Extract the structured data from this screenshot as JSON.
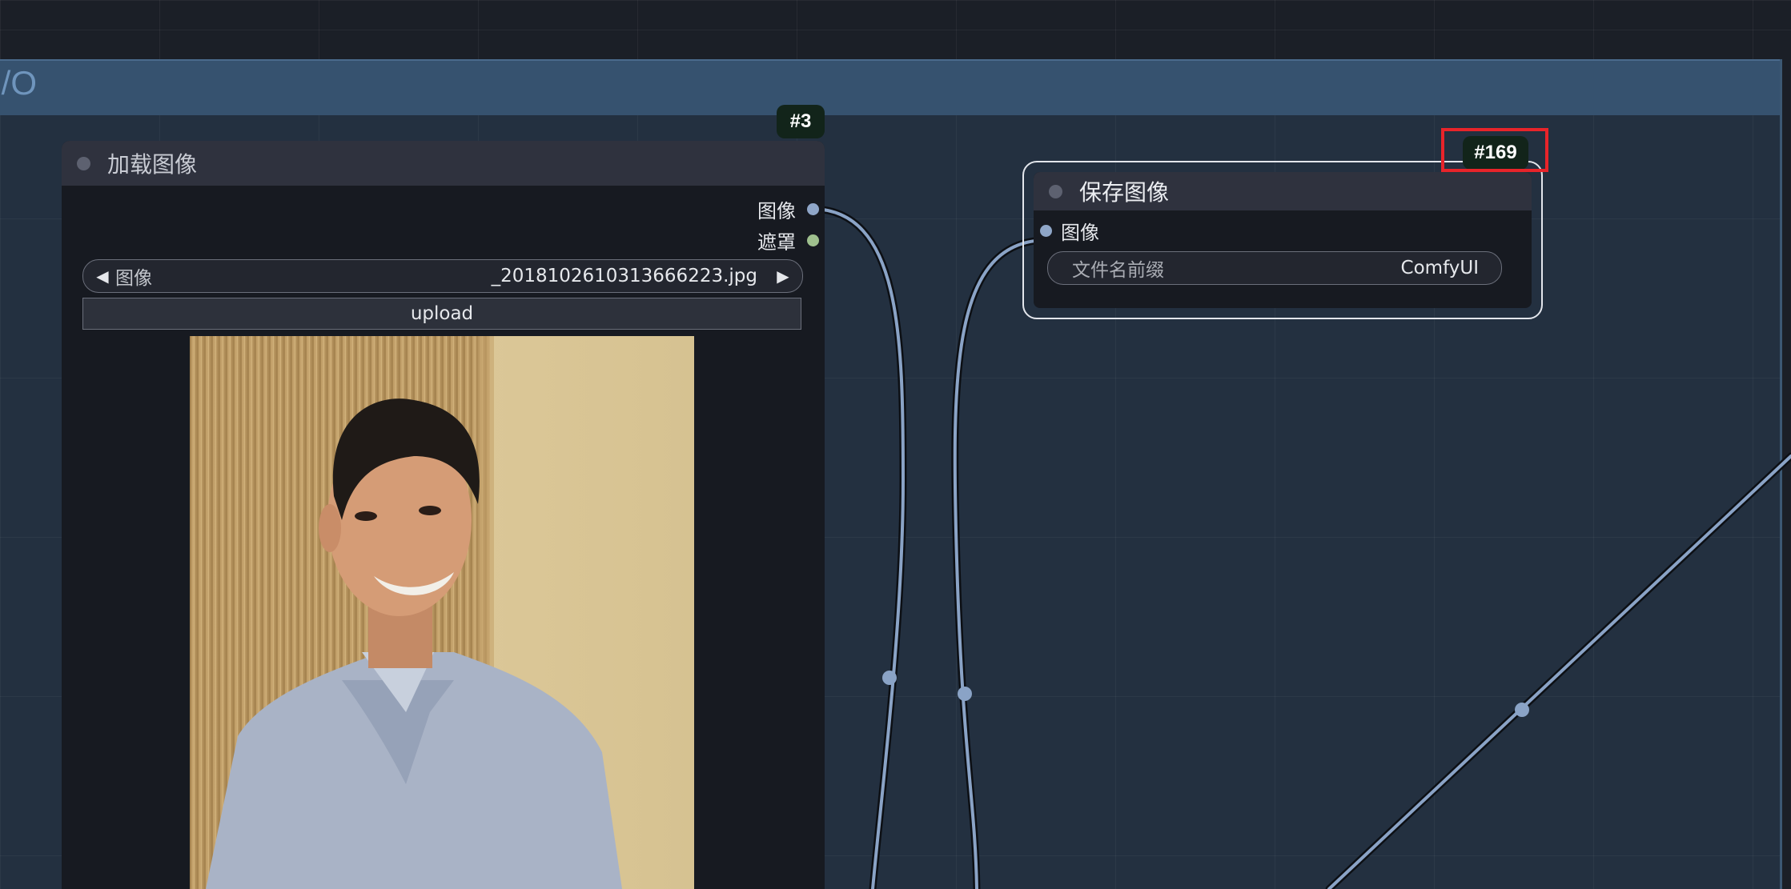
{
  "group": {
    "title": "I/O"
  },
  "load_image_node": {
    "id_badge": "#3",
    "title": "加载图像",
    "outputs": [
      {
        "label": "图像",
        "color": "#8fa6c8"
      },
      {
        "label": "遮罩",
        "color": "#9fc08e"
      }
    ],
    "image_widget": {
      "name": "图像",
      "value": "_2018102610313666223.jpg"
    },
    "upload_button": "upload",
    "preview_icon": "portrait-photo"
  },
  "save_image_node": {
    "id_badge": "#169",
    "title": "保存图像",
    "input": {
      "label": "图像",
      "color": "#8fa6c8"
    },
    "filename_prefix": {
      "label": "文件名前缀",
      "value": "ComfyUI"
    }
  },
  "colors": {
    "link": "#8aa3c6",
    "group_header": "#36526f",
    "highlight": "#e8242a"
  }
}
